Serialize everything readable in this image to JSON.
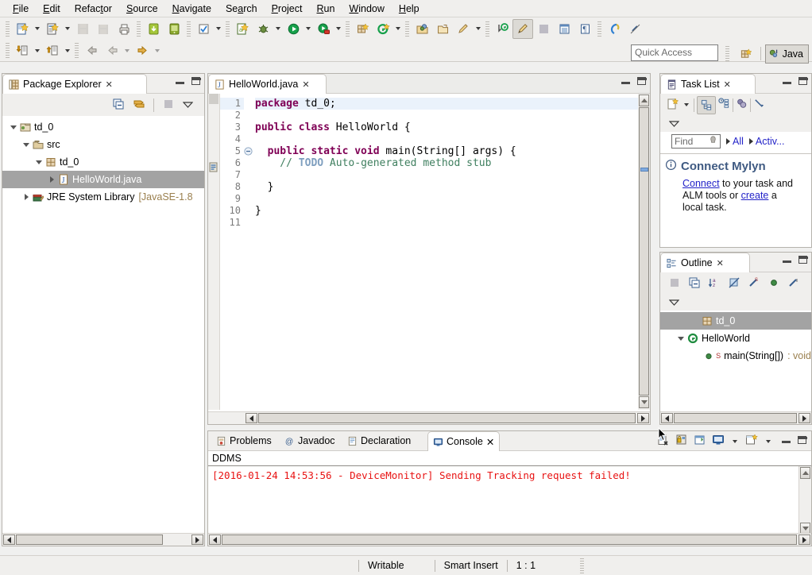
{
  "menubar": {
    "items": [
      {
        "label": "File",
        "mnemonic": "F"
      },
      {
        "label": "Edit",
        "mnemonic": "E"
      },
      {
        "label": "Refactor",
        "mnemonic": "t"
      },
      {
        "label": "Source",
        "mnemonic": "S"
      },
      {
        "label": "Navigate",
        "mnemonic": "N"
      },
      {
        "label": "Search",
        "mnemonic": "a"
      },
      {
        "label": "Project",
        "mnemonic": "P"
      },
      {
        "label": "Run",
        "mnemonic": "R"
      },
      {
        "label": "Window",
        "mnemonic": "W"
      },
      {
        "label": "Help",
        "mnemonic": "H"
      }
    ]
  },
  "toolbar": {
    "row1_icons": [
      "new-wizard-icon",
      "new-java-file-icon",
      "save-icon",
      "save-all-icon",
      "print-icon",
      "android-sdk-manager-icon",
      "android-avd-manager-icon",
      "check-icon",
      "new-android-project-icon",
      "debug-icon",
      "run-icon",
      "run-coverage-icon",
      "new-package-icon",
      "new-annotation-icon",
      "open-type-icon",
      "open-task-icon",
      "edit-icon",
      "last-edit-location-icon",
      "toggle-mark-occurrences-icon",
      "open-perspective-icon",
      "show-view-icon",
      "pilcrow-icon",
      "search-icon",
      "link-break-icon"
    ],
    "row2_icons": [
      "import-icon",
      "export-icon",
      "back-history-icon",
      "back-icon",
      "forward-icon"
    ]
  },
  "quick_access": {
    "placeholder": "Quick Access"
  },
  "perspective": {
    "label": "Java",
    "open_perspective_icon": "open-perspective-icon"
  },
  "package_explorer": {
    "title": "Package Explorer",
    "tab_icon": "package-explorer-icon",
    "toolbar_icons": [
      "collapse-all-icon",
      "link-with-editor-icon",
      "view-menu-icon",
      "chevron-down-icon"
    ],
    "tree": [
      {
        "label": "td_0",
        "icon": "java-project-icon",
        "depth": 0,
        "expanded": true,
        "selected": false,
        "suffix": ""
      },
      {
        "label": "src",
        "icon": "source-folder-icon",
        "depth": 1,
        "expanded": true,
        "selected": false,
        "suffix": ""
      },
      {
        "label": "td_0",
        "icon": "package-icon",
        "depth": 2,
        "expanded": true,
        "selected": false,
        "suffix": ""
      },
      {
        "label": "HelloWorld.java",
        "icon": "java-file-icon",
        "depth": 3,
        "expanded": false,
        "selected": true,
        "suffix": ""
      },
      {
        "label": "JRE System Library",
        "icon": "library-icon",
        "depth": 1,
        "expanded": false,
        "selected": false,
        "suffix": "[JavaSE-1.8"
      }
    ]
  },
  "editor": {
    "tab_label": "HelloWorld.java",
    "tab_icon": "java-file-icon",
    "close_glyph": "✕",
    "lines": [
      {
        "num": "1",
        "highlight": true,
        "fold": "",
        "marker": "",
        "tokens": [
          {
            "t": "package ",
            "c": "kw"
          },
          {
            "t": "td_0;",
            "c": ""
          }
        ]
      },
      {
        "num": "2",
        "highlight": false,
        "fold": "",
        "marker": "",
        "tokens": []
      },
      {
        "num": "3",
        "highlight": false,
        "fold": "",
        "marker": "",
        "tokens": [
          {
            "t": "public class ",
            "c": "kw"
          },
          {
            "t": "HelloWorld {",
            "c": ""
          }
        ]
      },
      {
        "num": "4",
        "highlight": false,
        "fold": "",
        "marker": "",
        "tokens": []
      },
      {
        "num": "5",
        "highlight": false,
        "fold": "collapse",
        "marker": "",
        "tokens": [
          {
            "t": "  public static void ",
            "c": "kw"
          },
          {
            "t": "main(String[] args) {",
            "c": ""
          }
        ]
      },
      {
        "num": "6",
        "highlight": false,
        "fold": "",
        "marker": "todo-task-icon",
        "tokens": [
          {
            "t": "    // ",
            "c": "cm"
          },
          {
            "t": "TODO",
            "c": "todo"
          },
          {
            "t": " Auto-generated method stub",
            "c": "cm"
          }
        ]
      },
      {
        "num": "7",
        "highlight": false,
        "fold": "",
        "marker": "",
        "tokens": []
      },
      {
        "num": "8",
        "highlight": false,
        "fold": "",
        "marker": "",
        "tokens": [
          {
            "t": "  }",
            "c": ""
          }
        ]
      },
      {
        "num": "9",
        "highlight": false,
        "fold": "",
        "marker": "",
        "tokens": []
      },
      {
        "num": "10",
        "highlight": false,
        "fold": "",
        "marker": "",
        "tokens": [
          {
            "t": "}",
            "c": ""
          }
        ]
      },
      {
        "num": "11",
        "highlight": false,
        "fold": "",
        "marker": "",
        "tokens": []
      }
    ]
  },
  "task_list": {
    "title": "Task List",
    "tab_icon": "task-list-icon",
    "toolbar_icons": [
      "new-task-icon",
      "chevron-down-icon",
      "categorized-presentation-icon",
      "scheduled-presentation-icon",
      "focus-on-workweek-icon",
      "link-with-editor-icon",
      "view-menu-icon"
    ],
    "find_placeholder": "Find",
    "find_icon": "search-icon",
    "filters": [
      {
        "label": "All"
      },
      {
        "label": "Activ..."
      }
    ],
    "notice": {
      "icon": "info-icon",
      "title": "Connect Mylyn",
      "link1": "Connect",
      "text1": " to your task and",
      "text2": "ALM tools or ",
      "link2": "create",
      "text3": " a",
      "text4": "local task."
    }
  },
  "outline": {
    "title": "Outline",
    "tab_icon": "outline-icon",
    "toolbar_icons": [
      "focus-icon",
      "collapse-all-icon",
      "sort-icon",
      "hide-fields-icon",
      "hide-static-icon",
      "hide-non-public-icon",
      "hide-local-types-icon",
      "view-menu-icon"
    ],
    "tree": [
      {
        "label": "td_0",
        "icon": "package-icon",
        "depth": 1,
        "selected": true,
        "expanded": false,
        "suffix": ""
      },
      {
        "label": "HelloWorld",
        "icon": "class-icon",
        "depth": 0,
        "selected": false,
        "expanded": true,
        "suffix": ""
      },
      {
        "label": "main(String[])",
        "icon": "public-method-icon",
        "depth": 2,
        "selected": false,
        "expanded": false,
        "suffix": " : void"
      }
    ]
  },
  "console_panel": {
    "tabs": [
      {
        "label": "Problems",
        "icon": "problems-icon",
        "active": false
      },
      {
        "label": "Javadoc",
        "icon": "javadoc-icon",
        "active": false
      },
      {
        "label": "Declaration",
        "icon": "declaration-icon",
        "active": false
      },
      {
        "label": "Console",
        "icon": "console-icon",
        "active": true
      }
    ],
    "close_glyph": "✕",
    "toolbar_icons": [
      "clear-console-icon",
      "scroll-lock-icon",
      "pin-console-icon",
      "display-selected-console-icon",
      "chevron-down-icon",
      "open-console-icon",
      "chevron-down-icon-2"
    ],
    "source_label": "DDMS",
    "message": "[2016-01-24 14:53:56 - DeviceMonitor] Sending Tracking request failed!",
    "message_color": "#e81313"
  },
  "status_bar": {
    "writable": "Writable",
    "insert_mode": "Smart Insert",
    "position": "1 : 1"
  },
  "colors": {
    "keyword": "#7f0055",
    "comment": "#3f7f5f",
    "todo": "#7f9fbf",
    "selection": "#a3a3a3",
    "link": "#2222c8",
    "chrome": "#f0efed",
    "error": "#e81313"
  }
}
